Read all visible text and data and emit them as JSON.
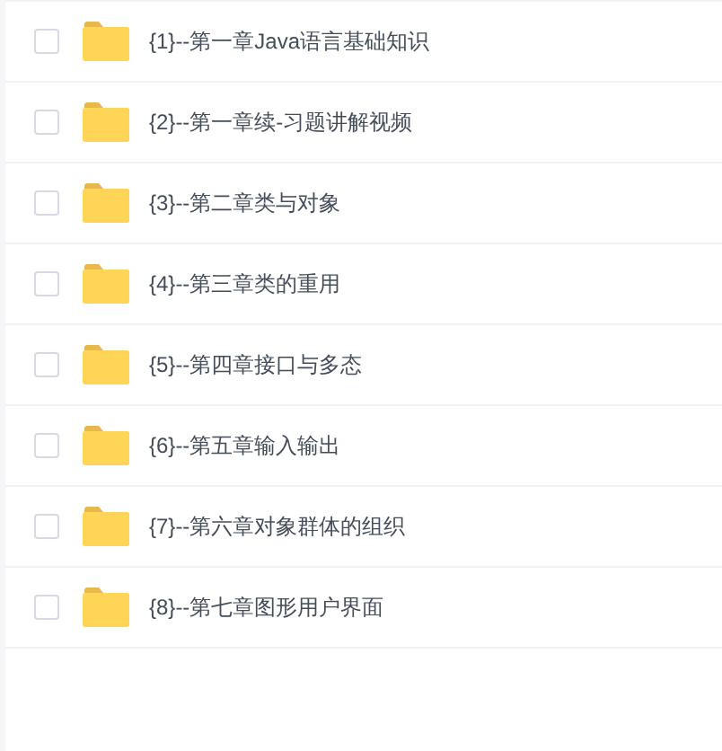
{
  "files": [
    {
      "name": "{1}--第一章Java语言基础知识",
      "checked": false
    },
    {
      "name": "{2}--第一章续-习题讲解视频",
      "checked": false
    },
    {
      "name": "{3}--第二章类与对象",
      "checked": false
    },
    {
      "name": "{4}--第三章类的重用",
      "checked": false
    },
    {
      "name": "{5}--第四章接口与多态",
      "checked": false
    },
    {
      "name": "{6}--第五章输入输出",
      "checked": false
    },
    {
      "name": "{7}--第六章对象群体的组织",
      "checked": false
    },
    {
      "name": "{8}--第七章图形用户界面",
      "checked": false
    }
  ]
}
